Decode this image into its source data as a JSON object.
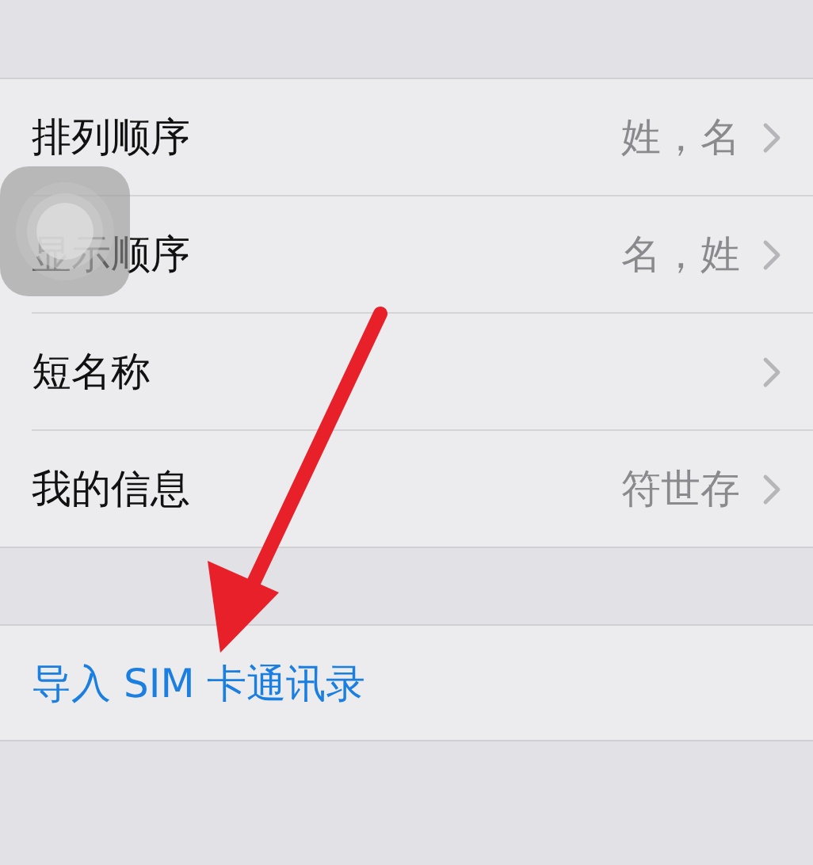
{
  "settings": [
    {
      "label": "排列顺序",
      "value": "姓，名"
    },
    {
      "label": "显示顺序",
      "value": "名，姓"
    },
    {
      "label": "短名称"
    },
    {
      "label": "我的信息",
      "value": "符世存"
    }
  ],
  "import_link": {
    "label": "导入 SIM 卡通讯录"
  }
}
